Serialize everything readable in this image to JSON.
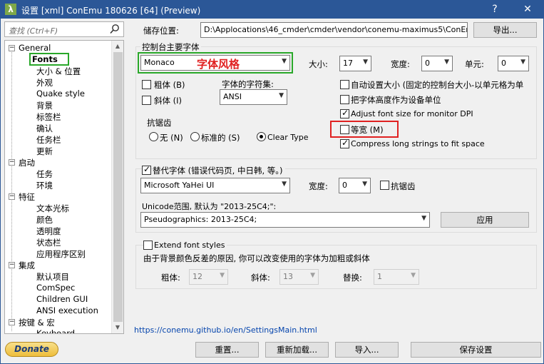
{
  "window": {
    "title": "设置 [xml] ConEmu 180626 [64] (Preview)",
    "app_icon": "λ",
    "help_glyph": "?",
    "close_glyph": "✕"
  },
  "sidebar": {
    "search_placeholder": "查找  (Ctrl+F)",
    "tree": [
      {
        "label": "General",
        "level": 0,
        "expander": "−"
      },
      {
        "label": "Fonts",
        "level": 1,
        "selected": true
      },
      {
        "label": "大小 & 位置",
        "level": 1
      },
      {
        "label": "外观",
        "level": 1
      },
      {
        "label": "Quake style",
        "level": 1
      },
      {
        "label": "背景",
        "level": 1
      },
      {
        "label": "标签栏",
        "level": 1
      },
      {
        "label": "确认",
        "level": 1
      },
      {
        "label": "任务栏",
        "level": 1
      },
      {
        "label": "更新",
        "level": 1
      },
      {
        "label": "启动",
        "level": 0,
        "expander": "−"
      },
      {
        "label": "任务",
        "level": 1
      },
      {
        "label": "环境",
        "level": 1
      },
      {
        "label": "特征",
        "level": 0,
        "expander": "−"
      },
      {
        "label": "文本光标",
        "level": 1
      },
      {
        "label": "颜色",
        "level": 1
      },
      {
        "label": "透明度",
        "level": 1
      },
      {
        "label": "状态栏",
        "level": 1
      },
      {
        "label": "应用程序区别",
        "level": 1
      },
      {
        "label": "集成",
        "level": 0,
        "expander": "−"
      },
      {
        "label": "默认项目",
        "level": 1
      },
      {
        "label": "ComSpec",
        "level": 1
      },
      {
        "label": "Children GUI",
        "level": 1
      },
      {
        "label": "ANSI execution",
        "level": 1
      },
      {
        "label": "按键 & 宏",
        "level": 0,
        "expander": "−"
      },
      {
        "label": "Keyboard",
        "level": 1
      }
    ],
    "donate_label": "Donate"
  },
  "storage": {
    "label": "储存位置:",
    "path": "D:\\Applocations\\46_cmder\\cmder\\vendor\\conemu-maximus5\\ConEmu.xml",
    "export_label": "导出..."
  },
  "main_font": {
    "group_label": "控制台主要字体",
    "font_name": "Monaco",
    "annotation": "字体风格",
    "size_label": "大小:",
    "size_value": "17",
    "width_label": "宽度:",
    "width_value": "0",
    "cell_label": "单元:",
    "cell_value": "0",
    "bold_label": "粗体 (B)",
    "italic_label": "斜体 (I)",
    "charset_label": "字体的字符集:",
    "charset_value": "ANSI",
    "auto_size_label": "自动设置大小 (固定的控制台大小-以单元格为单",
    "font_height_units_label": "把字体高度作为设备单位",
    "adjust_dpi_label": "Adjust font size for monitor DPI",
    "monospace_label": "等宽 (M)",
    "compress_label": "Compress long strings to fit space",
    "antialias_group_label": "抗锯齿",
    "aa_none": "无 (N)",
    "aa_standard": "标准的 (S)",
    "aa_cleartype": "Clear Type"
  },
  "alt_font": {
    "checkbox_label": "替代字体 (错误代码页, 中日韩, 等。)",
    "font_name": "Microsoft YaHei UI",
    "width_label": "宽度:",
    "width_value": "0",
    "antialias_label": "抗锯齿",
    "unicode_label": "Unicode范围, 默认为 \"2013-25C4;\":",
    "unicode_value": "Pseudographics: 2013-25C4;",
    "apply_label": "应用"
  },
  "extend": {
    "checkbox_label": "Extend font styles",
    "description": "由于背景颜色反差的原因, 你可以改变使用的字体为加粗或斜体",
    "bold_label": "粗体:",
    "bold_value": "12",
    "italic_label": "斜体:",
    "italic_value": "13",
    "replace_label": "替换:",
    "replace_value": "1"
  },
  "footer": {
    "help_link": "https://conemu.github.io/en/SettingsMain.html",
    "reset_label": "重置...",
    "reload_label": "重新加载...",
    "import_label": "导入...",
    "save_label": "保存设置"
  },
  "colors": {
    "titlebar": "#2b5797",
    "highlight_green": "#2aa82a",
    "highlight_red": "#e02020",
    "annotation_red": "#e02020"
  }
}
